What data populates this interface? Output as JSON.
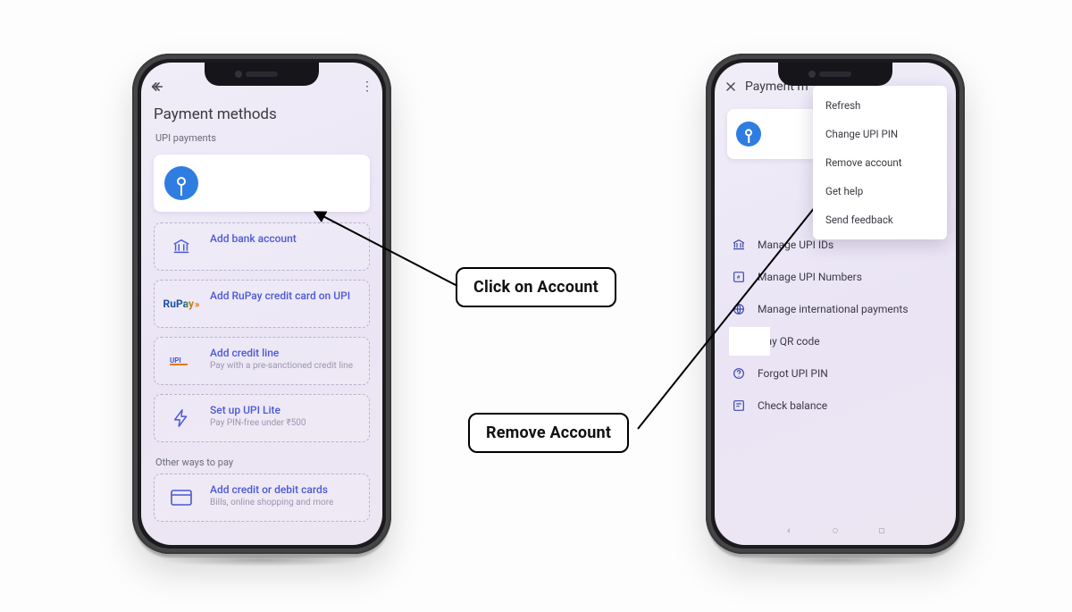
{
  "left": {
    "screen_title": "Payment methods",
    "section_upi": "UPI payments",
    "rows": {
      "add_bank": {
        "label": "Add bank account"
      },
      "rupay": {
        "brand": "RuPay",
        "label": "Add RuPay credit card on UPI"
      },
      "credit_line": {
        "label": "Add credit line",
        "sub": "Pay with a pre-sanctioned credit line"
      },
      "upi_lite": {
        "label": "Set up UPI Lite",
        "sub": "Pay PIN-free under ₹500"
      }
    },
    "section_other": "Other ways to pay",
    "add_cards": {
      "label": "Add credit or debit cards",
      "sub": "Bills, online shopping and more"
    }
  },
  "right": {
    "screen_title": "Payment m",
    "menu": {
      "refresh": "Refresh",
      "change_pin": "Change UPI PIN",
      "remove": "Remove account",
      "help": "Get help",
      "feedback": "Send feedback"
    },
    "options": {
      "upi_ids": "Manage UPI IDs",
      "upi_nums": "Manage UPI Numbers",
      "intl": "Manage international payments",
      "qr": "play QR code",
      "forgot": "Forgot UPI PIN",
      "balance": "Check balance"
    }
  },
  "callouts": {
    "click_account": "Click on Account",
    "remove_account": "Remove Account"
  }
}
